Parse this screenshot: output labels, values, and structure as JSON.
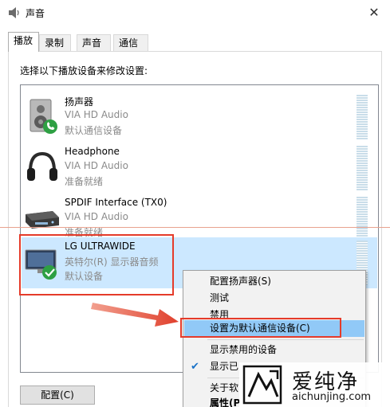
{
  "window": {
    "title": "声音",
    "close_glyph": "✕"
  },
  "tabs": [
    {
      "label": "播放",
      "active": true
    },
    {
      "label": "录制",
      "active": false
    },
    {
      "label": "声音",
      "active": false
    },
    {
      "label": "通信",
      "active": false
    }
  ],
  "instruction": "选择以下播放设备来修改设置:",
  "devices": [
    {
      "name": "扬声器",
      "driver": "VIA HD Audio",
      "status": "默认通信设备",
      "icon": "speaker-icon",
      "badge": "phone-badge-icon",
      "selected": false
    },
    {
      "name": "Headphone",
      "driver": "VIA HD Audio",
      "status": "准备就绪",
      "icon": "headphone-icon",
      "selected": false
    },
    {
      "name": "SPDIF Interface (TX0)",
      "driver": "VIA HD Audio",
      "status": "准备就绪",
      "icon": "spdif-device-icon",
      "selected": false
    },
    {
      "name": "LG ULTRAWIDE",
      "driver": "英特尔(R) 显示器音频",
      "status": "默认设备",
      "icon": "monitor-icon",
      "badge": "default-check-icon",
      "selected": true
    }
  ],
  "context_menu": {
    "items": [
      {
        "label": "配置扬声器(S)"
      },
      {
        "label": "测试"
      },
      {
        "label": "禁用"
      },
      {
        "label": "设置为默认通信设备(C)",
        "highlighted": true
      },
      {
        "label": "显示禁用的设备"
      },
      {
        "label": "显示已",
        "checked": true
      },
      {
        "label": "关于软"
      },
      {
        "label": "属性(P",
        "bold": true
      }
    ]
  },
  "config_button": "配置(C)",
  "watermark": {
    "brand": "爱纯净",
    "url": "aichunjing.com"
  },
  "colors": {
    "annotation_red": "#e53b2a",
    "selection_blue": "#cce8ff",
    "menu_hover": "#91c9f7",
    "check_green": "#2ea043"
  }
}
